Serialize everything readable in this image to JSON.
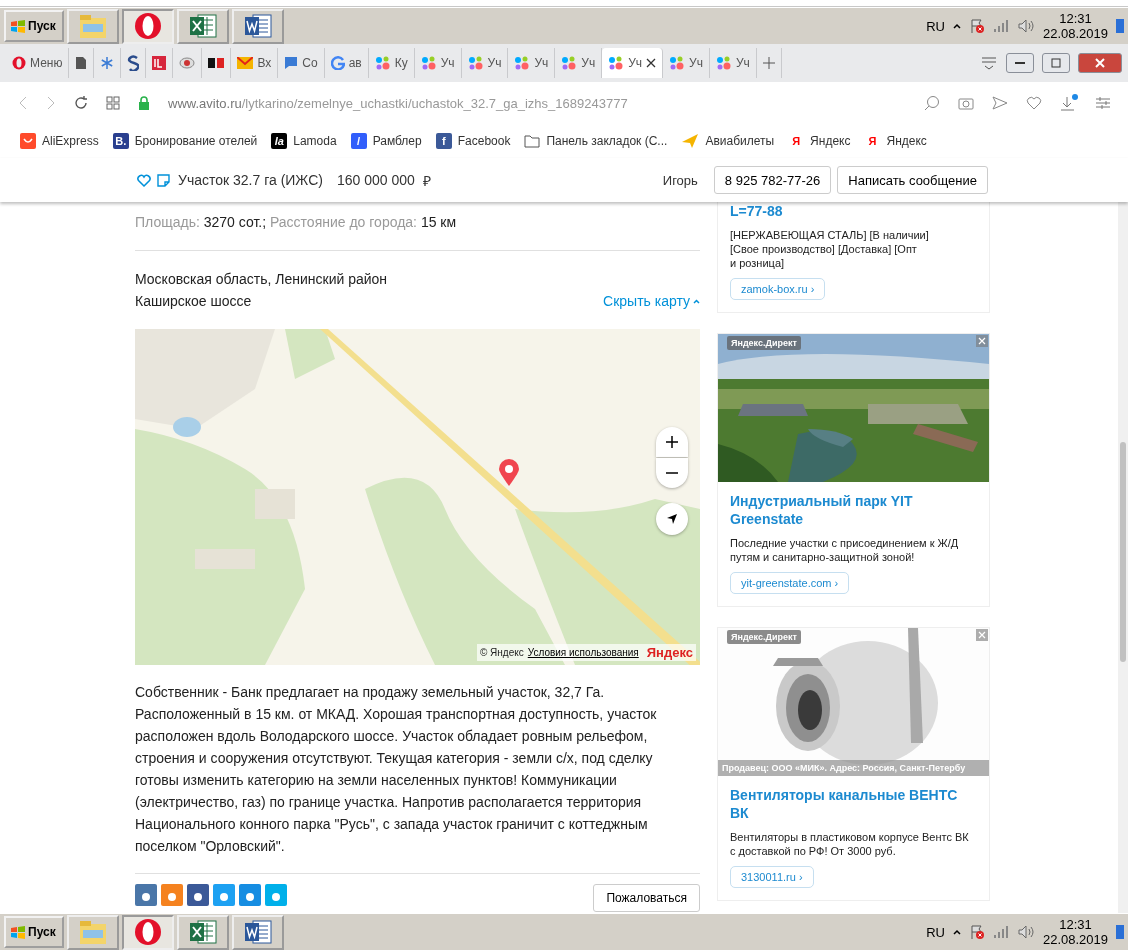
{
  "taskbars": [
    {
      "start": "Пуск",
      "lang": "RU",
      "time": "12:31",
      "date": "22.08.2019"
    },
    {
      "start": "Пуск",
      "lang": "RU",
      "time": "12:31",
      "date": "22.08.2019"
    }
  ],
  "browser": {
    "menu": "Меню",
    "tabs": [
      {
        "selected": false
      },
      {
        "selected": false
      },
      {
        "selected": false
      },
      {
        "selected": false
      },
      {
        "selected": false
      },
      {
        "selected": false
      },
      {
        "label": "Вх",
        "selected": false
      },
      {
        "label": "Со",
        "selected": false
      },
      {
        "label": "ав",
        "selected": false
      },
      {
        "label": "Ку",
        "selected": false
      },
      {
        "label": "Уч",
        "selected": false
      },
      {
        "label": "Уч",
        "selected": false
      },
      {
        "label": "Уч",
        "selected": false
      },
      {
        "label": "Уч",
        "selected": false
      },
      {
        "label": "Уч",
        "selected": true
      },
      {
        "label": "Уч",
        "selected": false
      },
      {
        "label": "Уч",
        "selected": false
      }
    ],
    "url_host": "www.avito.ru",
    "url_path": "/lytkarino/zemelnye_uchastki/uchastok_32.7_ga_izhs_1689243777",
    "bookmarks": [
      {
        "kind": "ali",
        "label": "AliExpress"
      },
      {
        "kind": "booking",
        "badge": "B.",
        "label": "Бронирование отелей"
      },
      {
        "kind": "lamoda",
        "badge": "la",
        "label": "Lamoda"
      },
      {
        "kind": "rambler",
        "badge": "/",
        "label": "Рамблер"
      },
      {
        "kind": "facebook",
        "badge": "f",
        "label": "Facebook"
      },
      {
        "kind": "folder",
        "label": "Панель закладок (С..."
      },
      {
        "kind": "plane",
        "label": "Авиабилеты"
      },
      {
        "kind": "yandex",
        "badge": "Я",
        "label": "Яндекс"
      },
      {
        "kind": "yandex",
        "badge": "Я",
        "label": "Яндекс"
      }
    ]
  },
  "header": {
    "title": "Участок 32.7 га (ИЖС)",
    "price": "160 000 000",
    "currency": "₽",
    "seller": "Игорь",
    "phone": "8 925 782-77-26",
    "message": "Написать сообщение"
  },
  "params": [
    {
      "label": "Площадь:",
      "value": "3270 сот.;"
    },
    {
      "label": "Расстояние до города:",
      "value": "15 км"
    }
  ],
  "address": [
    "Московская область, Ленинский район",
    "Каширское шоссе"
  ],
  "map_toggle": "Скрыть карту",
  "map": {
    "copyright": "© Яндекс",
    "terms": "Условия использования",
    "logo": "Яндекс"
  },
  "description": "Собственник - Банк предлагает на продажу земельный участок, 32,7 Га. Расположенный в 15 км. от МКАД. Хорошая транспортная доступность, участок расположен вдоль Володарского шоссе. Участок обладает ровным рельефом, строения и сооружения отсутствуют. Текущая категория - земли с/х, под сделку готовы изменить категорию на земли населенных пунктов! Коммуникации (электричество, газ) по границе участка. Напротив располагается территория Национального конного парка \"Русь\", с запада участок граничит с коттеджным поселком \"Орловский\".",
  "complaint": "Пожаловаться",
  "ads": [
    {
      "kind": "text",
      "title": "L=77-88",
      "body": [
        "[НЕРЖАВЕЮЩАЯ СТАЛЬ] [В наличии]",
        "[Свое производство] [Доставка] [Опт",
        "и розница]"
      ],
      "link": "zamok-box.ru ›"
    },
    {
      "kind": "landscape",
      "label": "Яндекс.Директ",
      "title": "Индустриальный парк YIT Greenstate",
      "body": [
        "Последние участки с присоединением к Ж/Д путям и санитарно-защитной зоной!"
      ],
      "link": "yit-greenstate.com ›"
    },
    {
      "kind": "product",
      "label": "Яндекс.Директ",
      "caption": "Продавец: ООО «МИК». Адрес: Россия, Санкт-Петербу",
      "title": "Вентиляторы канальные ВЕНТС ВК",
      "body": [
        "Вентиляторы в пластиковом корпусе Вентс ВК с доставкой по РФ! От 3000 руб."
      ],
      "link": "3130011.ru ›"
    }
  ]
}
